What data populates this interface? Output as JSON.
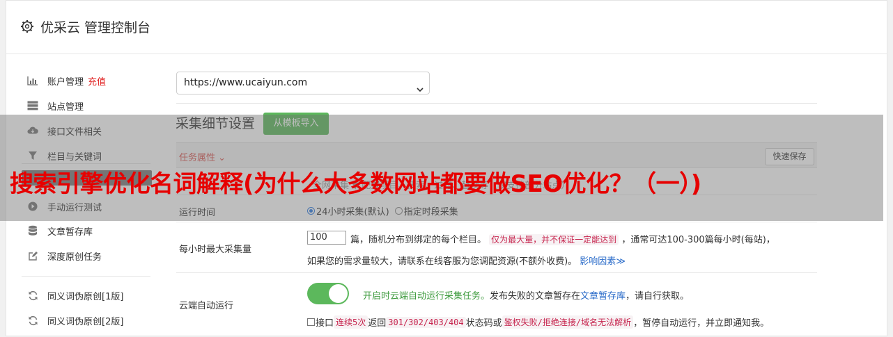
{
  "header": {
    "title": "优采云 管理控制台",
    "icon": "gear-icon"
  },
  "sidebar": {
    "items": [
      {
        "label": "账户管理",
        "badge": "充值",
        "icon": "bar-chart-icon"
      },
      {
        "label": "站点管理",
        "icon": "server-icon"
      },
      {
        "label": "接口文件相关",
        "icon": "cloud-download-icon"
      },
      {
        "label": "栏目与关键词",
        "icon": "filter-icon"
      },
      {
        "label": "采集细节设置",
        "icon": "settings-icon"
      },
      {
        "label": "手动运行测试",
        "icon": "play-icon"
      },
      {
        "label": "文章暂存库",
        "icon": "database-icon"
      },
      {
        "label": "深度原创任务",
        "icon": "edit-icon"
      },
      {
        "label": "同义词伪原创[1版]",
        "icon": "refresh-icon"
      },
      {
        "label": "同义词伪原创[2版]",
        "icon": "refresh-icon"
      }
    ]
  },
  "site_select": {
    "value": "https://www.ucaiyun.com"
  },
  "section": {
    "title": "采集细节设置",
    "import_button": "从模板导入"
  },
  "task": {
    "title": "任务属性",
    "quick_save": "快速保存"
  },
  "rows": {
    "mode_hint": "全网采集 ▼  配置项目、搜索、过滤、替换等（仅支持部分站点）",
    "run_time": {
      "label": "运行时间",
      "opt1": "24小时采集(默认)",
      "opt2": "指定时段采集"
    },
    "max_per_hour": {
      "label": "每小时最大采集量",
      "value": "100",
      "t1": "篇，随机分布到绑定的每个栏目。",
      "code1": "仅为最大量，并不保证一定能达到",
      "t2": "，通常可达100-300篇每小时(每站)，",
      "t3": "如果您的需求量较大，请联系在线客服为您调配资源(不额外收费)。",
      "link": "影响因素",
      "chev": "≫"
    },
    "cloud_run": {
      "label": "云端自动运行",
      "green": "开启时云端自动运行采集任务。",
      "t1": "发布失败的文章暂存在",
      "link": "文章暂存库",
      "t2": "，请自行获取。",
      "cb_label": "接口",
      "code1": "连续5次",
      "t3": "返回",
      "code2": "301/302/403/404",
      "t4": "状态码或",
      "code3": "鉴权失败/拒绝连接/域名无法解析",
      "t5": "，暂停自动运行，并立即通知我。"
    }
  },
  "overlay": {
    "text": "搜索引擎优化名词解释(为什么大多数网站都要做SEO优化？（一）)"
  },
  "colors": {
    "accent_green": "#5cb85c",
    "danger": "#e01e1e",
    "overlay_text": "#e60000"
  }
}
